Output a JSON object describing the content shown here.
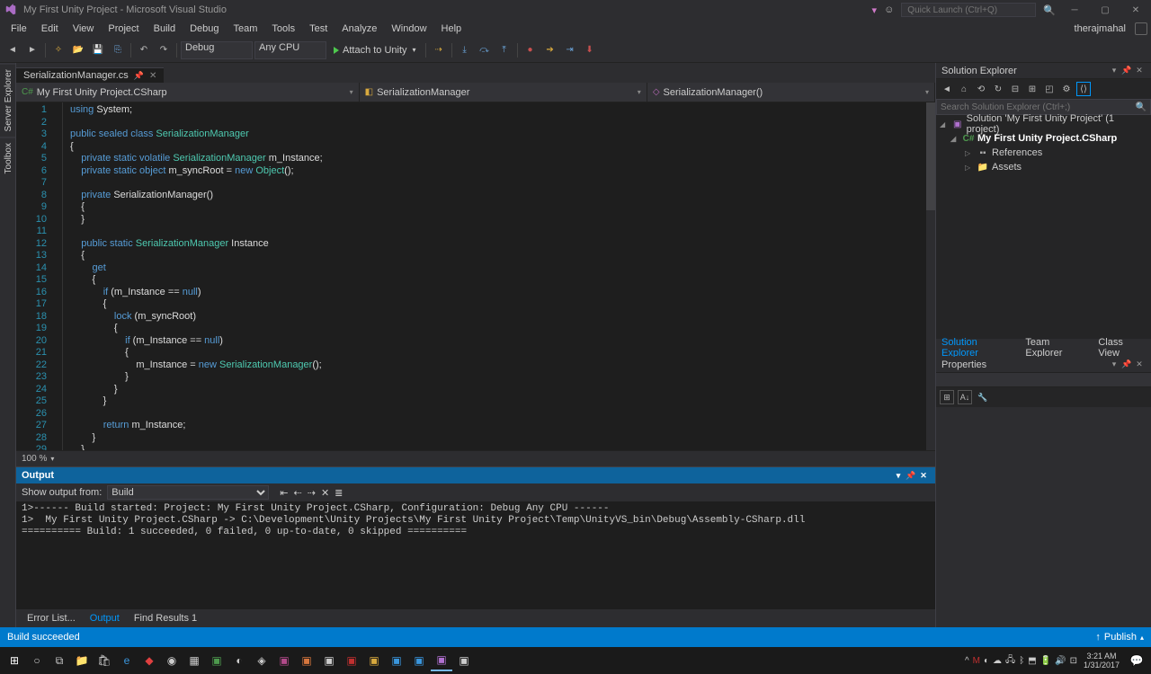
{
  "window": {
    "title": "My First Unity Project - Microsoft Visual Studio",
    "quick_launch_placeholder": "Quick Launch (Ctrl+Q)",
    "user": "therajmahal"
  },
  "menu": [
    "File",
    "Edit",
    "View",
    "Project",
    "Build",
    "Debug",
    "Team",
    "Tools",
    "Test",
    "Analyze",
    "Window",
    "Help"
  ],
  "toolbar": {
    "config": "Debug",
    "platform": "Any CPU",
    "attach": "Attach to Unity"
  },
  "doc_tab": {
    "file": "SerializationManager.cs"
  },
  "breadcrumb": {
    "project": "My First Unity Project.CSharp",
    "class": "SerializationManager",
    "member": "SerializationManager()"
  },
  "code": {
    "lines": 30,
    "tokens": [
      [
        {
          "t": "kw",
          "v": "using"
        },
        {
          "t": "",
          "v": " System;"
        }
      ],
      [],
      [
        {
          "t": "kw",
          "v": "public sealed class"
        },
        {
          "t": "",
          "v": " "
        },
        {
          "t": "type",
          "v": "SerializationManager"
        }
      ],
      [
        {
          "t": "",
          "v": "{"
        }
      ],
      [
        {
          "t": "",
          "v": "    "
        },
        {
          "t": "kw",
          "v": "private static volatile"
        },
        {
          "t": "",
          "v": " "
        },
        {
          "t": "type",
          "v": "SerializationManager"
        },
        {
          "t": "",
          "v": " m_Instance;"
        }
      ],
      [
        {
          "t": "",
          "v": "    "
        },
        {
          "t": "kw",
          "v": "private static object"
        },
        {
          "t": "",
          "v": " m_syncRoot = "
        },
        {
          "t": "kw",
          "v": "new"
        },
        {
          "t": "",
          "v": " "
        },
        {
          "t": "type",
          "v": "Object"
        },
        {
          "t": "",
          "v": "();"
        }
      ],
      [],
      [
        {
          "t": "",
          "v": "    "
        },
        {
          "t": "kw",
          "v": "private"
        },
        {
          "t": "",
          "v": " SerializationManager()"
        }
      ],
      [
        {
          "t": "",
          "v": "    {"
        }
      ],
      [
        {
          "t": "",
          "v": "    }"
        }
      ],
      [],
      [
        {
          "t": "",
          "v": "    "
        },
        {
          "t": "kw",
          "v": "public static"
        },
        {
          "t": "",
          "v": " "
        },
        {
          "t": "type",
          "v": "SerializationManager"
        },
        {
          "t": "",
          "v": " Instance"
        }
      ],
      [
        {
          "t": "",
          "v": "    {"
        }
      ],
      [
        {
          "t": "",
          "v": "        "
        },
        {
          "t": "kw",
          "v": "get"
        }
      ],
      [
        {
          "t": "",
          "v": "        {"
        }
      ],
      [
        {
          "t": "",
          "v": "            "
        },
        {
          "t": "kw",
          "v": "if"
        },
        {
          "t": "",
          "v": " (m_Instance == "
        },
        {
          "t": "kw",
          "v": "null"
        },
        {
          "t": "",
          "v": ")"
        }
      ],
      [
        {
          "t": "",
          "v": "            {"
        }
      ],
      [
        {
          "t": "",
          "v": "                "
        },
        {
          "t": "kw",
          "v": "lock"
        },
        {
          "t": "",
          "v": " (m_syncRoot)"
        }
      ],
      [
        {
          "t": "",
          "v": "                {"
        }
      ],
      [
        {
          "t": "",
          "v": "                    "
        },
        {
          "t": "kw",
          "v": "if"
        },
        {
          "t": "",
          "v": " (m_Instance == "
        },
        {
          "t": "kw",
          "v": "null"
        },
        {
          "t": "",
          "v": ")"
        }
      ],
      [
        {
          "t": "",
          "v": "                    {"
        }
      ],
      [
        {
          "t": "",
          "v": "                        m_Instance = "
        },
        {
          "t": "kw",
          "v": "new"
        },
        {
          "t": "",
          "v": " "
        },
        {
          "t": "type",
          "v": "SerializationManager"
        },
        {
          "t": "",
          "v": "();"
        }
      ],
      [
        {
          "t": "",
          "v": "                    }"
        }
      ],
      [
        {
          "t": "",
          "v": "                }"
        }
      ],
      [
        {
          "t": "",
          "v": "            }"
        }
      ],
      [],
      [
        {
          "t": "",
          "v": "            "
        },
        {
          "t": "kw",
          "v": "return"
        },
        {
          "t": "",
          "v": " m_Instance;"
        }
      ],
      [
        {
          "t": "",
          "v": "        }"
        }
      ],
      [
        {
          "t": "",
          "v": "    }"
        }
      ],
      [
        {
          "t": "",
          "v": "}"
        }
      ]
    ]
  },
  "zoom": "100 %",
  "output": {
    "title": "Output",
    "show_from_label": "Show output from:",
    "show_from_value": "Build",
    "lines": [
      "1>------ Build started: Project: My First Unity Project.CSharp, Configuration: Debug Any CPU ------",
      "1>  My First Unity Project.CSharp -> C:\\Development\\Unity Projects\\My First Unity Project\\Temp\\UnityVS_bin\\Debug\\Assembly-CSharp.dll",
      "========== Build: 1 succeeded, 0 failed, 0 up-to-date, 0 skipped =========="
    ]
  },
  "bottom_tabs": [
    "Error List...",
    "Output",
    "Find Results 1"
  ],
  "solution_explorer": {
    "title": "Solution Explorer",
    "search_placeholder": "Search Solution Explorer (Ctrl+;)",
    "root": "Solution 'My First Unity Project' (1 project)",
    "project": "My First Unity Project.CSharp",
    "references": "References",
    "assets": "Assets"
  },
  "right_tabs": [
    "Solution Explorer",
    "Team Explorer",
    "Class View"
  ],
  "properties": {
    "title": "Properties"
  },
  "status": {
    "text": "Build succeeded",
    "publish": "Publish"
  },
  "taskbar": {
    "time": "3:21 AM",
    "date": "1/31/2017"
  }
}
